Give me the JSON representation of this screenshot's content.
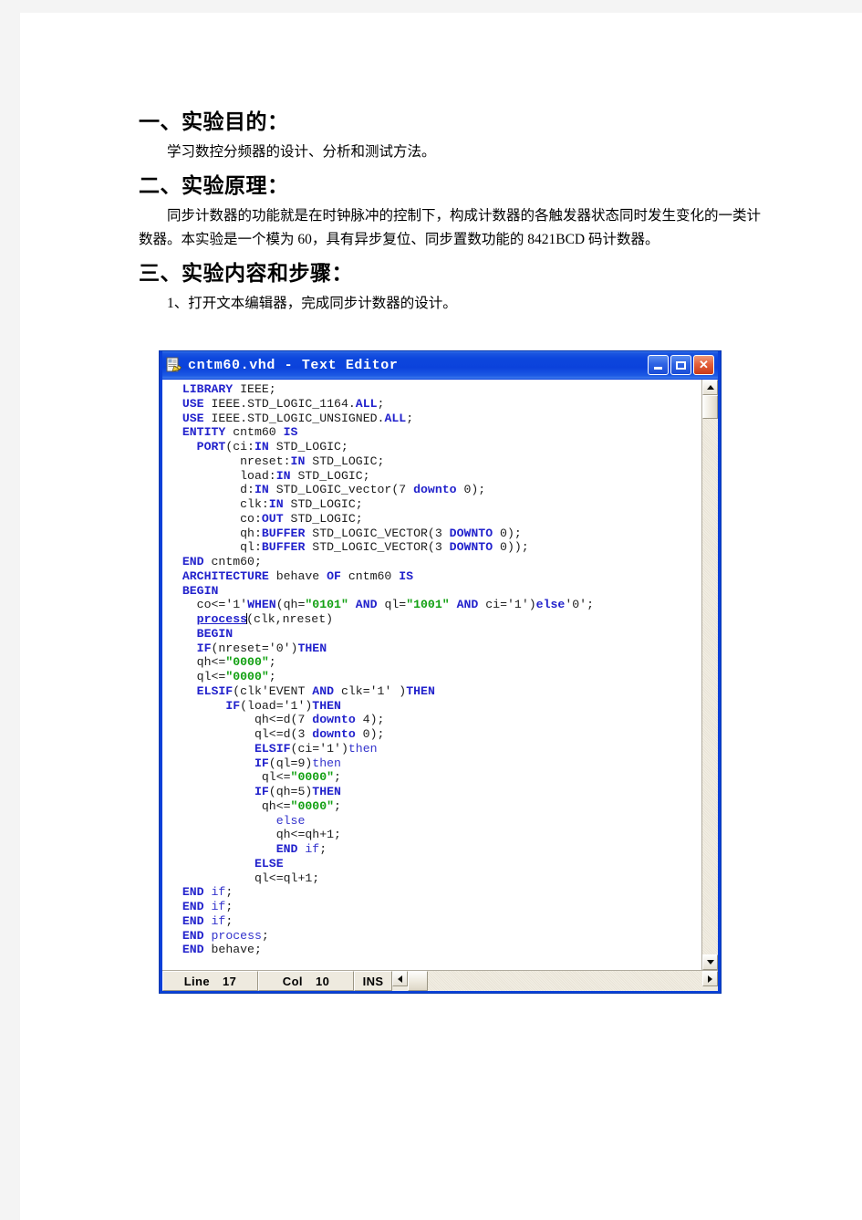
{
  "document": {
    "sections": [
      {
        "heading": "一、实验目的：",
        "paragraphs": [
          "学习数控分频器的设计、分析和测试方法。"
        ]
      },
      {
        "heading": "二、实验原理：",
        "paragraphs": [
          "同步计数器的功能就是在时钟脉冲的控制下，构成计数器的各触发器状态同时发生变化的一类计数器。本实验是一个模为 60，具有异步复位、同步置数功能的 8421BCD 码计数器。"
        ]
      },
      {
        "heading": "三、实验内容和步骤：",
        "paragraphs": [
          "1、打开文本编辑器，完成同步计数器的设计。"
        ]
      }
    ]
  },
  "editor": {
    "title": "cntm60.vhd - Text Editor",
    "icon": "document-pencil-icon",
    "window_buttons": {
      "minimize": "minimize-icon",
      "maximize": "maximize-icon",
      "close": "✕"
    },
    "statusbar": {
      "line_label": "Line",
      "line_value": "17",
      "col_label": "Col",
      "col_value": "10",
      "insert_mode": "INS"
    },
    "code_lines": [
      [
        {
          "t": "  ",
          "c": "pl"
        },
        {
          "t": "LIBRARY",
          "c": "kw"
        },
        {
          "t": " IEEE;",
          "c": "pl"
        }
      ],
      [
        {
          "t": "  ",
          "c": "pl"
        },
        {
          "t": "USE",
          "c": "kw"
        },
        {
          "t": " IEEE",
          "c": "pl"
        },
        {
          "t": ".",
          "c": "pl"
        },
        {
          "t": "STD_LOGIC_1164",
          "c": "pl"
        },
        {
          "t": ".",
          "c": "pl"
        },
        {
          "t": "ALL",
          "c": "kw"
        },
        {
          "t": ";",
          "c": "pl"
        }
      ],
      [
        {
          "t": "  ",
          "c": "pl"
        },
        {
          "t": "USE",
          "c": "kw"
        },
        {
          "t": " IEEE",
          "c": "pl"
        },
        {
          "t": ".",
          "c": "pl"
        },
        {
          "t": "STD_LOGIC_UNSIGNED",
          "c": "pl"
        },
        {
          "t": ".",
          "c": "pl"
        },
        {
          "t": "ALL",
          "c": "kw"
        },
        {
          "t": ";",
          "c": "pl"
        }
      ],
      [
        {
          "t": "  ",
          "c": "pl"
        },
        {
          "t": "ENTITY",
          "c": "kw"
        },
        {
          "t": " cntm60 ",
          "c": "pl"
        },
        {
          "t": "IS",
          "c": "kw"
        }
      ],
      [
        {
          "t": "    ",
          "c": "pl"
        },
        {
          "t": "PORT",
          "c": "kw"
        },
        {
          "t": "(ci:",
          "c": "pl"
        },
        {
          "t": "IN",
          "c": "kw"
        },
        {
          "t": " STD_LOGIC;",
          "c": "pl"
        }
      ],
      [
        {
          "t": "          nreset:",
          "c": "pl"
        },
        {
          "t": "IN",
          "c": "kw"
        },
        {
          "t": " STD_LOGIC;",
          "c": "pl"
        }
      ],
      [
        {
          "t": "          load:",
          "c": "pl"
        },
        {
          "t": "IN",
          "c": "kw"
        },
        {
          "t": " STD_LOGIC;",
          "c": "pl"
        }
      ],
      [
        {
          "t": "          d:",
          "c": "pl"
        },
        {
          "t": "IN",
          "c": "kw"
        },
        {
          "t": " STD_LOGIC_vector(7 ",
          "c": "pl"
        },
        {
          "t": "downto",
          "c": "kw"
        },
        {
          "t": " 0);",
          "c": "pl"
        }
      ],
      [
        {
          "t": "          clk:",
          "c": "pl"
        },
        {
          "t": "IN",
          "c": "kw"
        },
        {
          "t": " STD_LOGIC;",
          "c": "pl"
        }
      ],
      [
        {
          "t": "          co:",
          "c": "pl"
        },
        {
          "t": "OUT",
          "c": "kw"
        },
        {
          "t": " STD_LOGIC;",
          "c": "pl"
        }
      ],
      [
        {
          "t": "          qh:",
          "c": "pl"
        },
        {
          "t": "BUFFER",
          "c": "kw"
        },
        {
          "t": " STD_LOGIC_VECTOR(3 ",
          "c": "pl"
        },
        {
          "t": "DOWNTO",
          "c": "kw"
        },
        {
          "t": " 0);",
          "c": "pl"
        }
      ],
      [
        {
          "t": "          ql:",
          "c": "pl"
        },
        {
          "t": "BUFFER",
          "c": "kw"
        },
        {
          "t": " STD_LOGIC_VECTOR(3 ",
          "c": "pl"
        },
        {
          "t": "DOWNTO",
          "c": "kw"
        },
        {
          "t": " 0));",
          "c": "pl"
        }
      ],
      [
        {
          "t": "  ",
          "c": "pl"
        },
        {
          "t": "END",
          "c": "kw"
        },
        {
          "t": " cntm60;",
          "c": "pl"
        }
      ],
      [
        {
          "t": "  ",
          "c": "pl"
        },
        {
          "t": "ARCHITECTURE",
          "c": "kw"
        },
        {
          "t": " behave ",
          "c": "pl"
        },
        {
          "t": "OF",
          "c": "kw"
        },
        {
          "t": " cntm60 ",
          "c": "pl"
        },
        {
          "t": "IS",
          "c": "kw"
        }
      ],
      [
        {
          "t": "  ",
          "c": "pl"
        },
        {
          "t": "BEGIN",
          "c": "kw"
        }
      ],
      [
        {
          "t": "    co<=",
          "c": "pl"
        },
        {
          "t": "'1'",
          "c": "pl"
        },
        {
          "t": "WHEN",
          "c": "kw"
        },
        {
          "t": "(qh=",
          "c": "pl"
        },
        {
          "t": "\"0101\"",
          "c": "str"
        },
        {
          "t": " ",
          "c": "pl"
        },
        {
          "t": "AND",
          "c": "kw"
        },
        {
          "t": " ql=",
          "c": "pl"
        },
        {
          "t": "\"1001\"",
          "c": "str"
        },
        {
          "t": " ",
          "c": "pl"
        },
        {
          "t": "AND",
          "c": "kw"
        },
        {
          "t": " ci=",
          "c": "pl"
        },
        {
          "t": "'1'",
          "c": "pl"
        },
        {
          "t": ")",
          "c": "pl"
        },
        {
          "t": "else",
          "c": "kw"
        },
        {
          "t": "'0';",
          "c": "pl"
        }
      ],
      [
        {
          "t": "    ",
          "c": "pl"
        },
        {
          "t": "process",
          "c": "sel"
        },
        {
          "t": "|CARET|",
          "c": "caret"
        },
        {
          "t": "(clk,nreset)",
          "c": "pl"
        }
      ],
      [
        {
          "t": "    ",
          "c": "pl"
        },
        {
          "t": "BEGIN",
          "c": "kw"
        }
      ],
      [
        {
          "t": "    ",
          "c": "pl"
        },
        {
          "t": "IF",
          "c": "kw"
        },
        {
          "t": "(nreset=",
          "c": "pl"
        },
        {
          "t": "'0'",
          "c": "pl"
        },
        {
          "t": ")",
          "c": "pl"
        },
        {
          "t": "THEN",
          "c": "kw"
        }
      ],
      [
        {
          "t": "    qh<=",
          "c": "pl"
        },
        {
          "t": "\"0000\"",
          "c": "str"
        },
        {
          "t": ";",
          "c": "pl"
        }
      ],
      [
        {
          "t": "    ql<=",
          "c": "pl"
        },
        {
          "t": "\"0000\"",
          "c": "str"
        },
        {
          "t": ";",
          "c": "pl"
        }
      ],
      [
        {
          "t": "    ",
          "c": "pl"
        },
        {
          "t": "ELSIF",
          "c": "kw"
        },
        {
          "t": "(clk",
          "c": "pl"
        },
        {
          "t": "'EVENT",
          "c": "pl"
        },
        {
          "t": " ",
          "c": "pl"
        },
        {
          "t": "AND",
          "c": "kw"
        },
        {
          "t": " clk=",
          "c": "pl"
        },
        {
          "t": "'1'",
          "c": "pl"
        },
        {
          "t": " )",
          "c": "pl"
        },
        {
          "t": "THEN",
          "c": "kw"
        }
      ],
      [
        {
          "t": "        ",
          "c": "pl"
        },
        {
          "t": "IF",
          "c": "kw"
        },
        {
          "t": "(load=",
          "c": "pl"
        },
        {
          "t": "'1'",
          "c": "pl"
        },
        {
          "t": ")",
          "c": "pl"
        },
        {
          "t": "THEN",
          "c": "kw"
        }
      ],
      [
        {
          "t": "            qh<=d(7 ",
          "c": "pl"
        },
        {
          "t": "downto",
          "c": "kw"
        },
        {
          "t": " 4);",
          "c": "pl"
        }
      ],
      [
        {
          "t": "            ql<=d(3 ",
          "c": "pl"
        },
        {
          "t": "downto",
          "c": "kw"
        },
        {
          "t": " 0);",
          "c": "pl"
        }
      ],
      [
        {
          "t": "            ",
          "c": "pl"
        },
        {
          "t": "ELSIF",
          "c": "kw"
        },
        {
          "t": "(ci=",
          "c": "pl"
        },
        {
          "t": "'1'",
          "c": "pl"
        },
        {
          "t": ")",
          "c": "pl"
        },
        {
          "t": "then",
          "c": "kwn"
        }
      ],
      [
        {
          "t": "            ",
          "c": "pl"
        },
        {
          "t": "IF",
          "c": "kw"
        },
        {
          "t": "(ql=9)",
          "c": "pl"
        },
        {
          "t": "then",
          "c": "kwn"
        }
      ],
      [
        {
          "t": "             ql<=",
          "c": "pl"
        },
        {
          "t": "\"0000\"",
          "c": "str"
        },
        {
          "t": ";",
          "c": "pl"
        }
      ],
      [
        {
          "t": "            ",
          "c": "pl"
        },
        {
          "t": "IF",
          "c": "kw"
        },
        {
          "t": "(qh=5)",
          "c": "pl"
        },
        {
          "t": "THEN",
          "c": "kw"
        }
      ],
      [
        {
          "t": "             qh<=",
          "c": "pl"
        },
        {
          "t": "\"0000\"",
          "c": "str"
        },
        {
          "t": ";",
          "c": "pl"
        }
      ],
      [
        {
          "t": "               ",
          "c": "pl"
        },
        {
          "t": "else",
          "c": "kwn"
        }
      ],
      [
        {
          "t": "               qh<=qh+1;",
          "c": "pl"
        }
      ],
      [
        {
          "t": "               ",
          "c": "pl"
        },
        {
          "t": "END",
          "c": "kw"
        },
        {
          "t": " ",
          "c": "pl"
        },
        {
          "t": "if",
          "c": "kwn"
        },
        {
          "t": ";",
          "c": "pl"
        }
      ],
      [
        {
          "t": "            ",
          "c": "pl"
        },
        {
          "t": "ELSE",
          "c": "kw"
        }
      ],
      [
        {
          "t": "            ql<=ql+1;",
          "c": "pl"
        }
      ],
      [
        {
          "t": "  ",
          "c": "pl"
        },
        {
          "t": "END",
          "c": "kw"
        },
        {
          "t": " ",
          "c": "pl"
        },
        {
          "t": "if",
          "c": "kwn"
        },
        {
          "t": ";",
          "c": "pl"
        }
      ],
      [
        {
          "t": "  ",
          "c": "pl"
        },
        {
          "t": "END",
          "c": "kw"
        },
        {
          "t": " ",
          "c": "pl"
        },
        {
          "t": "if",
          "c": "kwn"
        },
        {
          "t": ";",
          "c": "pl"
        }
      ],
      [
        {
          "t": "  ",
          "c": "pl"
        },
        {
          "t": "END",
          "c": "kw"
        },
        {
          "t": " ",
          "c": "pl"
        },
        {
          "t": "if",
          "c": "kwn"
        },
        {
          "t": ";",
          "c": "pl"
        }
      ],
      [
        {
          "t": "  ",
          "c": "pl"
        },
        {
          "t": "END",
          "c": "kw"
        },
        {
          "t": " ",
          "c": "pl"
        },
        {
          "t": "process",
          "c": "kwn"
        },
        {
          "t": ";",
          "c": "pl"
        }
      ],
      [
        {
          "t": "  ",
          "c": "pl"
        },
        {
          "t": "END",
          "c": "kw"
        },
        {
          "t": " behave;",
          "c": "pl"
        }
      ]
    ]
  },
  "colors": {
    "titlebar_blue": "#0c46dd",
    "keyword_blue": "#2222cc",
    "string_green": "#11a011",
    "chrome_gray": "#eeeadf"
  }
}
